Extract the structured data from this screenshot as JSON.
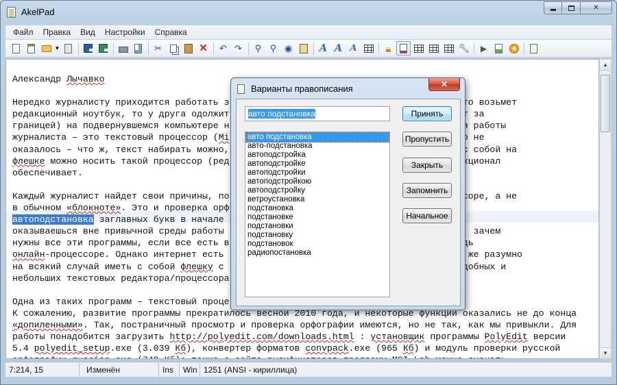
{
  "window": {
    "title": "AkelPad"
  },
  "menu": [
    "Файл",
    "Правка",
    "Вид",
    "Настройки",
    "Справка"
  ],
  "toolbar": {
    "buttons": [
      "new-file",
      "new-window",
      "open",
      "open-dropdown",
      "reopen",
      "save",
      "save-all",
      "print",
      "print-preview",
      "cut",
      "copy",
      "paste",
      "delete",
      "undo",
      "redo",
      "find",
      "replace",
      "spell-check",
      "clipboard",
      "font",
      "font-bigger",
      "font-smaller",
      "color",
      "read-only",
      "word-wrap",
      "split-window",
      "split-horizontal",
      "split-vertical",
      "tools",
      "run",
      "plugin",
      "settings",
      "notepad"
    ]
  },
  "editor": {
    "lines": [
      [
        "Александр ",
        {
          "t": "Лычавко",
          "sq": true
        }
      ],
      [
        ""
      ],
      [
        "Нередко журналисту приходится работать з                                 нет-кафе, то возьмет"
      ],
      [
        "редакционный ноутбук, то у друга одолжит                                о происходит за"
      ],
      [
        "границей) на подвернувшемся компьютере н                                программ для работы"
      ],
      [
        "журналиста – это текстовый процессор (",
        {
          "t": "Mi",
          "sq": true
        },
        "                                 пьютере его не"
      ],
      [
        "оказалось – что ж, текст набирать можно,                                Между тем, с собой на"
      ],
      [
        {
          "t": "флешке",
          "sq": true
        },
        " можно носить такой процессор (ред                                 нужный функционал"
      ],
      [
        "обеспечивает."
      ],
      [
        ""
      ],
      [
        "Каждый журналист найдет свои причины, по                                овом процессоре, а не"
      ],
      [
        "в обычном ",
        {
          "t": "«блокноте»",
          "sq": true
        },
        ". Это и проверка орф                                екста, и"
      ],
      [
        {
          "t": "автоподстановка",
          "sel": true
        },
        " заглавных букв в начале                                 очи. Когда"
      ],
      [
        "оказываешься вне привычной среды работы                                 скажет: мол, зачем"
      ],
      [
        "нужны все эти программы, если все есть в                                 каком-нибудь"
      ],
      [
        {
          "t": "онлайн",
          "sq": true
        },
        "-процессоре. Однако интернет есть                                 поэтому все же разумно"
      ],
      [
        "на всякий случай иметь с собой ",
        {
          "t": "флешку",
          "sq": true
        },
        " с                                 отрим два удобных и"
      ],
      [
        "небольших текстовых редактора/процессора                                вописания."
      ],
      [
        ""
      ],
      [
        "Одна из таких программ – текстовый проце"
      ],
      [
        "К сожалению, развитие программы прекратилось весной 2010 года, и некоторые функции оказались не до конца"
      ],
      [
        {
          "t": "«допиленными»",
          "sq": true
        },
        ". Так, постраничный просмотр и проверка орфографии имеются, но не так, как мы привыкли. Для"
      ],
      [
        "работы понадобится загрузить ",
        {
          "t": "http://polyedit.com/downloads.html",
          "sq": true
        },
        " : ",
        {
          "t": "установщик",
          "sq": true
        },
        " программы ",
        {
          "t": "PolyEdit",
          "sq": true
        },
        " версии"
      ],
      [
        "5.4 ",
        {
          "t": "polyedit_setup",
          "sq": true
        },
        ".exe (3.039 ",
        {
          "t": "Кб",
          "sq": true
        },
        "), конвертер форматов ",
        {
          "t": "convpack",
          "sq": true
        },
        ".exe (965 ",
        {
          "t": "Кб",
          "sq": true
        },
        ") и модуль проверки русской"
      ],
      [
        "орфографии russian.exe (749 Кб); также с сайта русификаторов программ MSI Lab можно скачать"
      ]
    ]
  },
  "status": {
    "position": "7:214, 15",
    "modified": "Изменён",
    "insert_mode": "Ins",
    "newline": "Win",
    "encoding": "1251  (ANSI - кириллица)"
  },
  "dialog": {
    "title": "Варианты правописания",
    "close_label": "✕",
    "input_value": "авто подстановка",
    "suggestions": [
      "авто подстановка",
      "авто-подстановка",
      "автоподстройка",
      "автоподстройке",
      "автоподстройки",
      "автоподстройкою",
      "автоподстройку",
      "ветроустановка",
      "подстановка",
      "подстановке",
      "подстановки",
      "подстановку",
      "подстановок",
      "радиопостановка"
    ],
    "selected_index": 0,
    "buttons": {
      "accept": "Принять",
      "skip": "Пропустить",
      "close": "Закрыть",
      "remember": "Запомнить",
      "initial": "Начальное"
    }
  }
}
